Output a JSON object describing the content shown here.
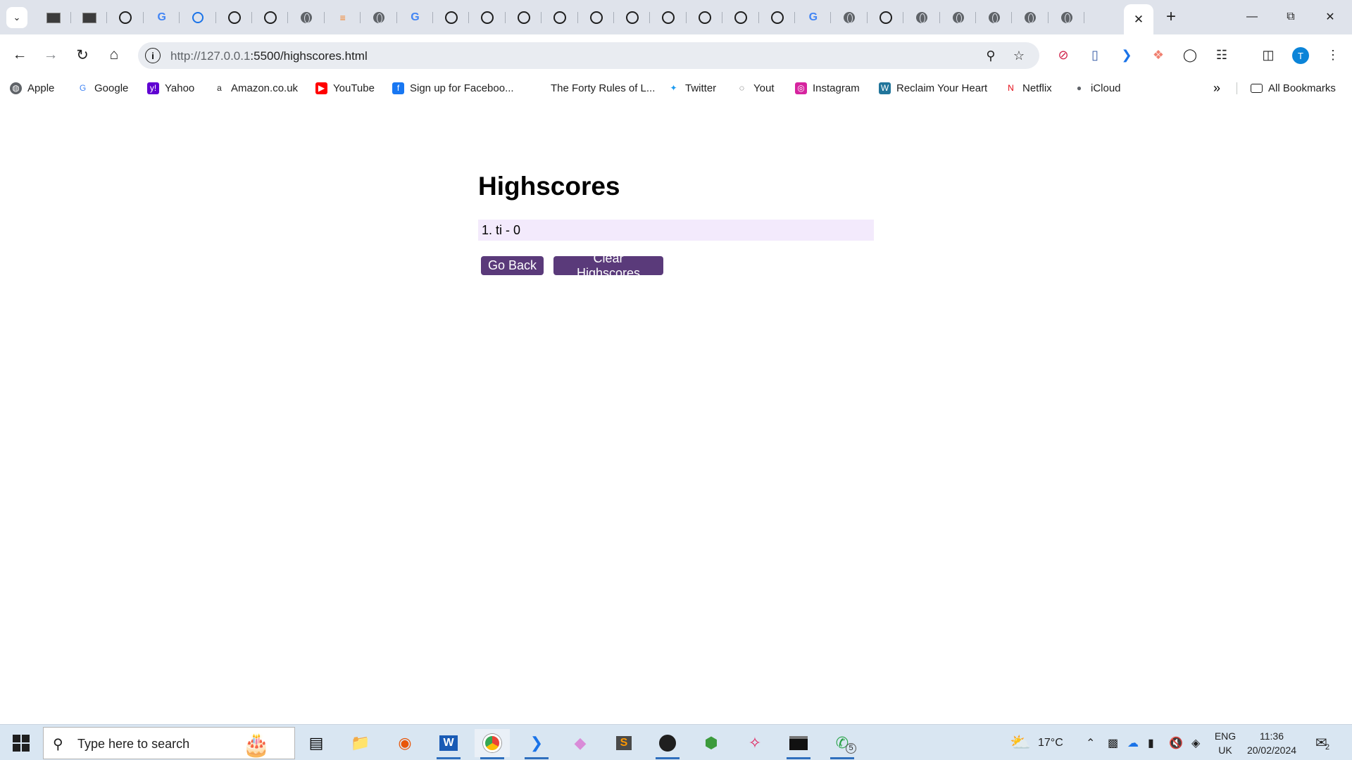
{
  "browser": {
    "tab_icons": [
      "dark-page-icon",
      "dark-page-icon",
      "github-icon",
      "google-icon",
      "history-icon",
      "github-icon",
      "github-icon",
      "globe-icon",
      "stackoverflow-icon",
      "globe-icon",
      "google-icon",
      "github-icon",
      "github-icon",
      "github-icon",
      "github-icon",
      "github-icon",
      "github-icon",
      "github-icon",
      "github-icon",
      "github-icon",
      "github-icon",
      "google-icon",
      "globe-icon",
      "github-icon",
      "globe-icon",
      "globe-icon",
      "globe-icon",
      "globe-icon",
      "globe-icon"
    ],
    "close_tab_glyph": "✕",
    "new_tab_glyph": "+",
    "url_host": "http://127.0.0.1",
    "url_rest": ":5500/highscores.html",
    "info_glyph": "i",
    "avatar_letter": "T"
  },
  "bookmarks": [
    {
      "label": "Apple",
      "icon": "globe-icon"
    },
    {
      "label": "Google",
      "icon": "google-icon"
    },
    {
      "label": "Yahoo",
      "icon": "yahoo-icon"
    },
    {
      "label": "Amazon.co.uk",
      "icon": "amazon-icon"
    },
    {
      "label": "YouTube",
      "icon": "youtube-icon"
    },
    {
      "label": "Sign up for Faceboo...",
      "icon": "facebook-icon"
    },
    {
      "label": "The Forty Rules of L...",
      "icon": "none"
    },
    {
      "label": "Twitter",
      "icon": "twitter-icon"
    },
    {
      "label": "Yout",
      "icon": "speech-icon"
    },
    {
      "label": "Instagram",
      "icon": "instagram-icon"
    },
    {
      "label": "Reclaim Your Heart",
      "icon": "wordpress-icon"
    },
    {
      "label": "Netflix",
      "icon": "netflix-icon"
    },
    {
      "label": "iCloud",
      "icon": "apple-icon"
    }
  ],
  "all_bookmarks_label": "All Bookmarks",
  "page": {
    "title": "Highscores",
    "scores": [
      "1. ti - 0"
    ],
    "go_back_label": "Go Back",
    "clear_label": "Clear Highscores"
  },
  "taskbar": {
    "search_placeholder": "Type here to search",
    "weather": "17°C",
    "lang_line1": "ENG",
    "lang_line2": "UK",
    "time": "11:36",
    "date": "20/02/2024",
    "whatsapp_badge": "5",
    "notifications_badge": "2"
  },
  "colors": {
    "button_bg": "#5a3a7a",
    "score_row_bg": "#f3eafc",
    "taskbar_bg": "#d9e6f2",
    "tabstrip_bg": "#dfe3eb"
  }
}
